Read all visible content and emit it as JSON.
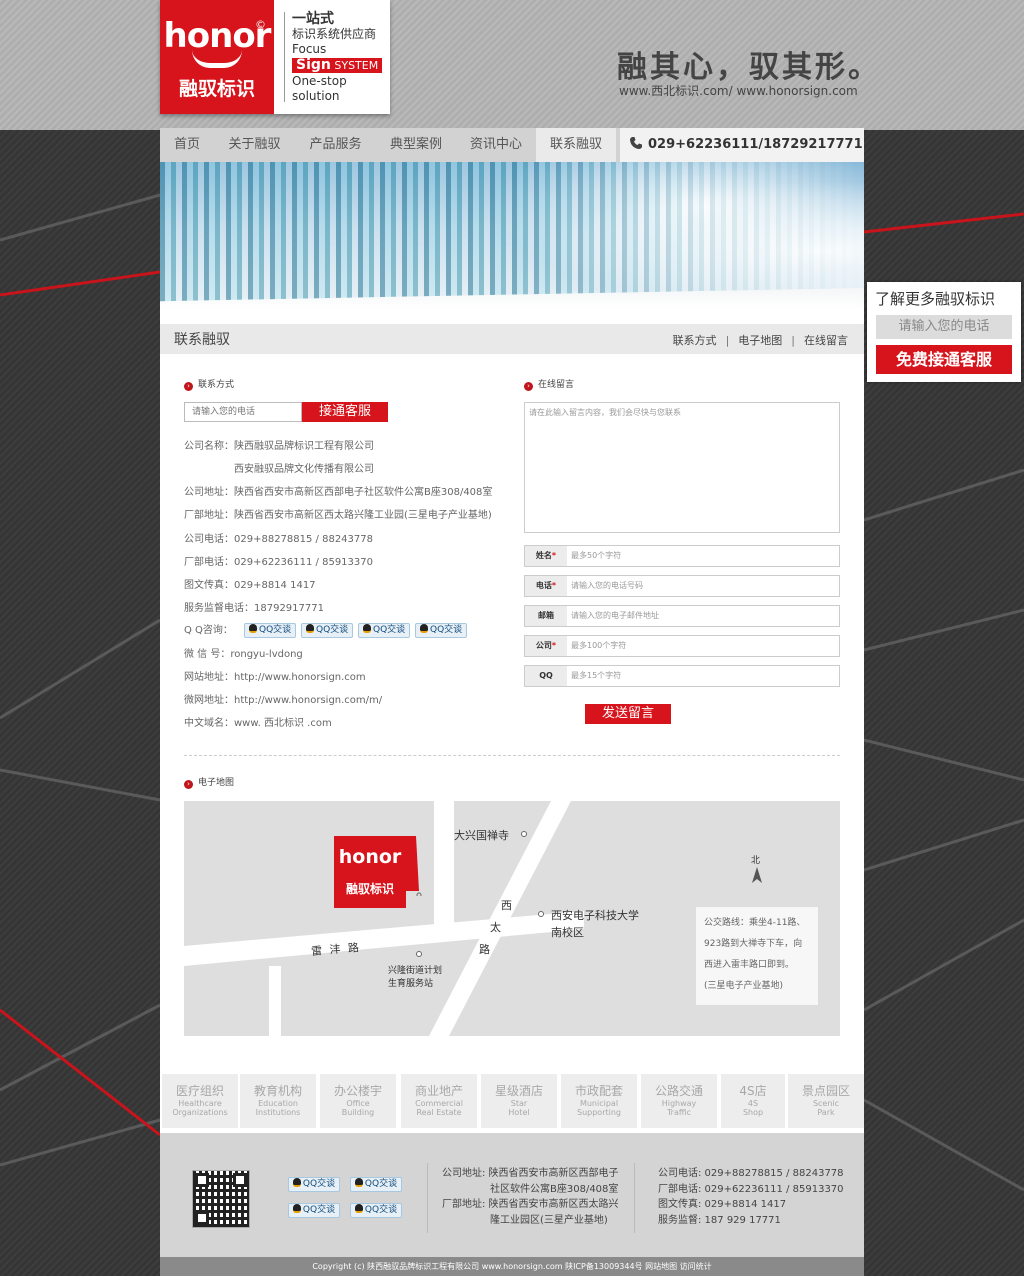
{
  "header": {
    "logo_brand": "honor",
    "logo_cn": "融驭标识",
    "logo_reg": "©",
    "tagline_1": "一站式",
    "tagline_2": "标识系统供应商",
    "tagline_3": "Focus",
    "tagline_sign": "Sign",
    "tagline_system": "SYSTEM",
    "tagline_4": "One-stop",
    "tagline_5": "solution",
    "slogan": "融其心，驭其形。",
    "slogan_url": "www.西北标识.com/ www.honorsign.com"
  },
  "nav": {
    "items": [
      "首页",
      "关于融驭",
      "产品服务",
      "典型案例",
      "资讯中心",
      "联系融驭"
    ],
    "active_index": 5,
    "phone": "029+62236111/18729217771"
  },
  "crumb": {
    "title": "联系融驭",
    "links": [
      "联系方式",
      "电子地图",
      "在线留言"
    ]
  },
  "contact": {
    "section_title": "联系方式",
    "phone_placeholder": "请输入您的电话",
    "call_button": "接通客服",
    "rows": [
      {
        "label": "公司名称：",
        "value": "陕西融驭品牌标识工程有限公司"
      },
      {
        "label": "",
        "value": "西安融驭品牌文化传播有限公司"
      },
      {
        "label": "公司地址：",
        "value": "陕西省西安市高新区西部电子社区软件公寓B座308/408室"
      },
      {
        "label": "厂部地址：",
        "value": "陕西省西安市高新区西太路兴隆工业园(三星电子产业基地)"
      },
      {
        "label": "公司电话：",
        "value": "029+88278815 / 88243778"
      },
      {
        "label": "厂部电话：",
        "value": "029+62236111 / 85913370"
      },
      {
        "label": "图文传真：",
        "value": "029+8814 1417"
      },
      {
        "label": "服务监督电话：",
        "value": "18792917771"
      }
    ],
    "qq_label": "Q Q咨询：",
    "qq_buttons": [
      "QQ交谈",
      "QQ交谈",
      "QQ交谈",
      "QQ交谈"
    ],
    "rows2": [
      {
        "label": "微 信 号：",
        "value": "rongyu-lvdong"
      },
      {
        "label": "网站地址：",
        "value": "http://www.honorsign.com"
      },
      {
        "label": "微网地址：",
        "value": "http://www.honorsign.com/m/"
      },
      {
        "label": "中文域名：",
        "value": "www. 西北标识 .com"
      }
    ]
  },
  "message": {
    "section_title": "在线留言",
    "textarea_placeholder": "请在此输入留言内容，我们会尽快与您联系",
    "fields": [
      {
        "label": "姓名",
        "required": true,
        "placeholder": "最多50个字符"
      },
      {
        "label": "电话",
        "required": true,
        "placeholder": "请输入您的电话号码"
      },
      {
        "label": "邮箱",
        "required": false,
        "placeholder": "请输入您的电子邮件地址"
      },
      {
        "label": "公司",
        "required": true,
        "placeholder": "最多100个字符"
      },
      {
        "label": "QQ",
        "required": false,
        "placeholder": "最多15个字符"
      }
    ],
    "required_mark": "*",
    "submit": "发送留言"
  },
  "map": {
    "section_title": "电子地图",
    "logo_brand": "honor",
    "logo_cn": "融驭标识",
    "labels": {
      "temple": "大兴国禅寺",
      "university_1": "西安电子科技大学",
      "university_2": "南校区",
      "road_leifeng": "雷 沣 路",
      "road_xitai_1": "西",
      "road_xitai_2": "太",
      "road_xitai_3": "路",
      "station_1": "兴隆街道计划",
      "station_2": "生育服务站",
      "north": "北"
    },
    "bus_lines": [
      "公交路线：乘坐4-11路、",
      "923路到大禅寺下车，向",
      "西进入雷丰路口即到。",
      "(三星电子产业基地)"
    ]
  },
  "categories": [
    {
      "cn": "医疗组织",
      "en1": "Healthcare",
      "en2": "Organizations"
    },
    {
      "cn": "教育机构",
      "en1": "Education",
      "en2": "Institutions"
    },
    {
      "cn": "办公楼宇",
      "en1": "Office",
      "en2": "Building"
    },
    {
      "cn": "商业地产",
      "en1": "Commercial",
      "en2": "Real Estate"
    },
    {
      "cn": "星级酒店",
      "en1": "Star",
      "en2": "Hotel"
    },
    {
      "cn": "市政配套",
      "en1": "Municipal",
      "en2": "Supporting"
    },
    {
      "cn": "公路交通",
      "en1": "Highway",
      "en2": "Traffic"
    },
    {
      "cn": "4S店",
      "en1": "4S",
      "en2": "Shop"
    },
    {
      "cn": "景点园区",
      "en1": "Scenic",
      "en2": "Park"
    }
  ],
  "footer": {
    "qq_buttons": [
      "QQ交谈",
      "QQ交谈",
      "QQ交谈",
      "QQ交谈"
    ],
    "address_lines": [
      "公司地址: 陕西省西安市高新区西部电子",
      "社区软件公寓B座308/408室",
      "厂部地址: 陕西省西安市高新区西太路兴",
      "隆工业园区(三星产业基地)"
    ],
    "phone_lines": [
      "公司电话: 029+88278815 / 88243778",
      "厂部电话: 029+62236111 / 85913370",
      "图文传真: 029+8814 1417",
      "服务监督: 187 929 17771"
    ],
    "copyright": "Copyright (c) 陕西融驭品牌标识工程有限公司 www.honorsign.com 陕ICP备13009344号 网站地图 访问统计"
  },
  "side": {
    "title": "了解更多融驭标识",
    "placeholder": "请输入您的电话",
    "button": "免费接通客服"
  },
  "colors": {
    "accent": "#d7131b",
    "nav_bg": "#d2d2d2",
    "page_bg": "#3a3a3a"
  }
}
